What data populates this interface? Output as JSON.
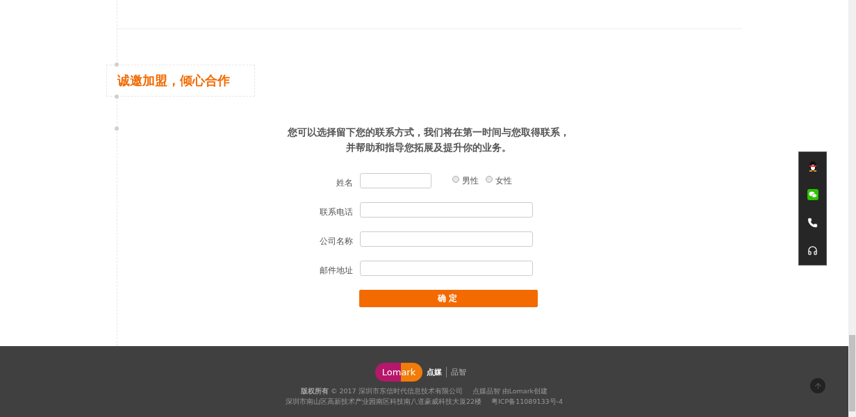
{
  "section_title": "诚邀加盟，倾心合作",
  "intro": [
    "您可以选择留下您的联系方式，我们将在第一时间与您取得联系，",
    "并帮助和指导您拓展及提升你的业务。"
  ],
  "form": {
    "fields": [
      {
        "label": "姓名",
        "kind": "short"
      },
      {
        "label": "联系电话",
        "kind": "long"
      },
      {
        "label": "公司名称",
        "kind": "long"
      },
      {
        "label": "邮件地址",
        "kind": "long"
      }
    ],
    "gender": [
      {
        "label": "男性",
        "selected": false
      },
      {
        "label": "女性",
        "selected": false
      }
    ],
    "submit": "确定"
  },
  "side_tools": [
    {
      "kind": "qq"
    },
    {
      "kind": "wechat"
    },
    {
      "kind": "phone"
    },
    {
      "kind": "headset"
    }
  ],
  "footer": {
    "logo": {
      "brand": "Lomark",
      "name": "点媒",
      "sub": "品智"
    },
    "lines": [
      [
        "**版权所有** © 2017 深圳市东信时代信息技术有限公司",
        "点媒品智 由Lomark创建"
      ],
      [
        "深圳市南山区高新技术产业园南区科技南八道豪威科技大厦22楼",
        "粤ICP备11089133号-4"
      ]
    ]
  }
}
